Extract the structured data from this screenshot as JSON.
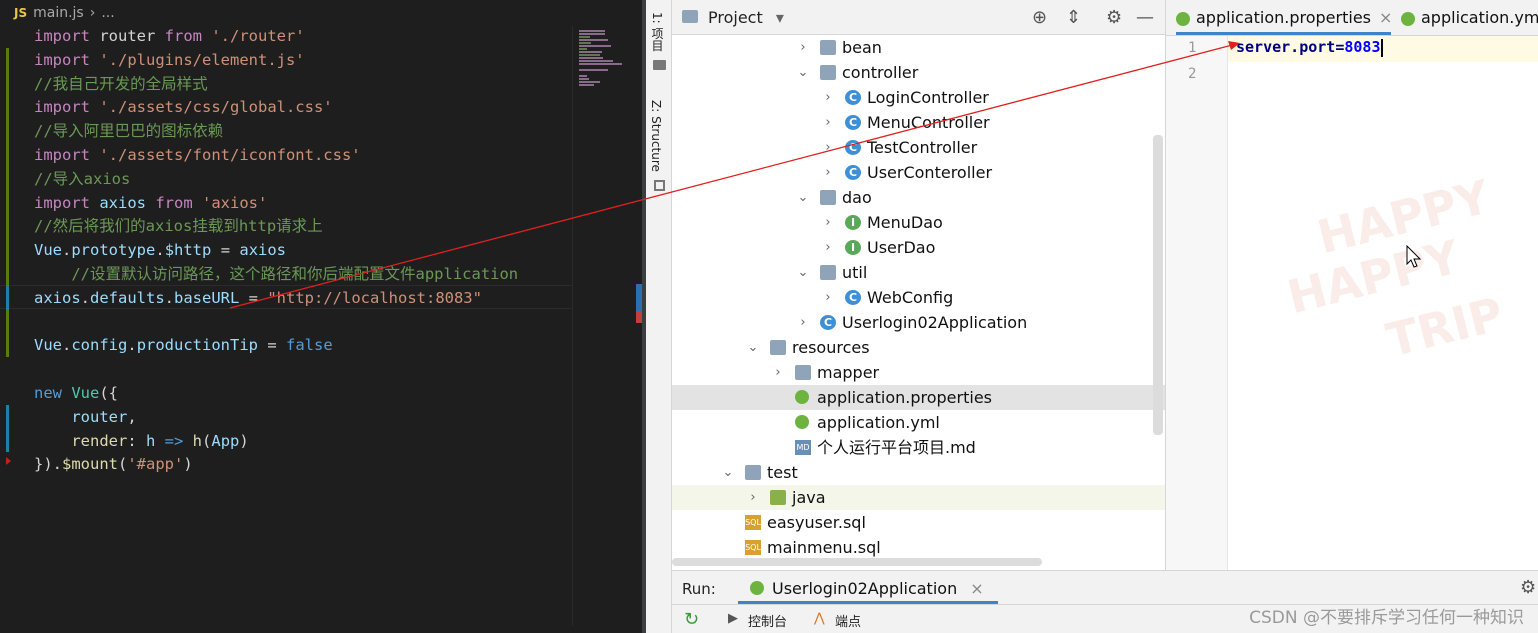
{
  "vscode": {
    "breadcrumb": {
      "badge": "JS",
      "file": "main.js",
      "sep": "›",
      "rest": "..."
    },
    "lines": [
      [
        {
          "c": "kw",
          "t": "import"
        },
        {
          "c": "op",
          "t": " router "
        },
        {
          "c": "kw",
          "t": "from"
        },
        {
          "c": "op",
          "t": " "
        },
        {
          "c": "str",
          "t": "'./router'"
        }
      ],
      [
        {
          "c": "kw",
          "t": "import"
        },
        {
          "c": "op",
          "t": " "
        },
        {
          "c": "str",
          "t": "'./plugins/element.js'"
        }
      ],
      [
        {
          "c": "cmt",
          "t": "//我自己开发的全局样式"
        }
      ],
      [
        {
          "c": "kw",
          "t": "import"
        },
        {
          "c": "op",
          "t": " "
        },
        {
          "c": "str",
          "t": "'./assets/css/global.css'"
        }
      ],
      [
        {
          "c": "cmt",
          "t": "//导入阿里巴巴的图标依赖"
        }
      ],
      [
        {
          "c": "kw",
          "t": "import"
        },
        {
          "c": "op",
          "t": " "
        },
        {
          "c": "str",
          "t": "'./assets/font/iconfont.css'"
        }
      ],
      [
        {
          "c": "cmt",
          "t": "//导入axios"
        }
      ],
      [
        {
          "c": "kw",
          "t": "import"
        },
        {
          "c": "id",
          "t": " axios "
        },
        {
          "c": "kw",
          "t": "from"
        },
        {
          "c": "op",
          "t": " "
        },
        {
          "c": "str",
          "t": "'axios'"
        }
      ],
      [
        {
          "c": "cmt",
          "t": "//然后将我们的axios挂载到http请求上"
        }
      ],
      [
        {
          "c": "id",
          "t": "Vue"
        },
        {
          "c": "op",
          "t": "."
        },
        {
          "c": "id",
          "t": "prototype"
        },
        {
          "c": "op",
          "t": "."
        },
        {
          "c": "id",
          "t": "$http"
        },
        {
          "c": "op",
          "t": " = "
        },
        {
          "c": "id",
          "t": "axios"
        }
      ],
      [
        {
          "c": "op",
          "t": "    "
        },
        {
          "c": "cmt",
          "t": "//设置默认访问路径，这个路径和你后端配置文件application"
        }
      ],
      [
        {
          "c": "id",
          "t": "axios"
        },
        {
          "c": "op",
          "t": "."
        },
        {
          "c": "id",
          "t": "defaults"
        },
        {
          "c": "op",
          "t": "."
        },
        {
          "c": "id",
          "t": "baseURL"
        },
        {
          "c": "op",
          "t": " = "
        },
        {
          "c": "str",
          "t": "\"http://localhost:8083\""
        }
      ],
      [],
      [
        {
          "c": "id",
          "t": "Vue"
        },
        {
          "c": "op",
          "t": "."
        },
        {
          "c": "id",
          "t": "config"
        },
        {
          "c": "op",
          "t": "."
        },
        {
          "c": "id",
          "t": "productionTip"
        },
        {
          "c": "op",
          "t": " = "
        },
        {
          "c": "kw2",
          "t": "false"
        }
      ],
      [],
      [
        {
          "c": "kw2",
          "t": "new"
        },
        {
          "c": "op",
          "t": " "
        },
        {
          "c": "cls",
          "t": "Vue"
        },
        {
          "c": "op",
          "t": "({"
        }
      ],
      [
        {
          "c": "op",
          "t": "    "
        },
        {
          "c": "id",
          "t": "router"
        },
        {
          "c": "op",
          "t": ","
        }
      ],
      [
        {
          "c": "op",
          "t": "    "
        },
        {
          "c": "fn",
          "t": "render"
        },
        {
          "c": "op",
          "t": ": "
        },
        {
          "c": "id",
          "t": "h"
        },
        {
          "c": "kw2",
          "t": " => "
        },
        {
          "c": "fn",
          "t": "h"
        },
        {
          "c": "op",
          "t": "("
        },
        {
          "c": "id",
          "t": "App"
        },
        {
          "c": "op",
          "t": ")"
        }
      ],
      [
        {
          "c": "op",
          "t": "})."
        },
        {
          "c": "fn",
          "t": "$mount"
        },
        {
          "c": "op",
          "t": "("
        },
        {
          "c": "str",
          "t": "'#app'"
        },
        {
          "c": "op",
          "t": ")"
        }
      ]
    ]
  },
  "idea": {
    "side_tabs": {
      "project": "1: 项目",
      "structure": "Z: Structure"
    },
    "project_panel": {
      "title": "Project",
      "dropdown_glyph": "▾",
      "icons": {
        "locate": "⊕",
        "collapse": "⇕",
        "settings": "⚙",
        "hide": "—"
      }
    },
    "tree": [
      {
        "label": "bean",
        "depth": 3,
        "arrow": "›",
        "icon": "folder"
      },
      {
        "label": "controller",
        "depth": 3,
        "arrow": "⌄",
        "icon": "folder"
      },
      {
        "label": "LoginController",
        "depth": 4,
        "arrow": "›",
        "icon": "class-c"
      },
      {
        "label": "MenuController",
        "depth": 4,
        "arrow": "›",
        "icon": "class-c"
      },
      {
        "label": "TestController",
        "depth": 4,
        "arrow": "›",
        "icon": "class-c"
      },
      {
        "label": "UserConteroller",
        "depth": 4,
        "arrow": "›",
        "icon": "class-c"
      },
      {
        "label": "dao",
        "depth": 3,
        "arrow": "⌄",
        "icon": "folder"
      },
      {
        "label": "MenuDao",
        "depth": 4,
        "arrow": "›",
        "icon": "class-i"
      },
      {
        "label": "UserDao",
        "depth": 4,
        "arrow": "›",
        "icon": "class-i"
      },
      {
        "label": "util",
        "depth": 3,
        "arrow": "⌄",
        "icon": "folder"
      },
      {
        "label": "WebConfig",
        "depth": 4,
        "arrow": "›",
        "icon": "class-c"
      },
      {
        "label": "Userlogin02Application",
        "depth": 3,
        "arrow": "›",
        "icon": "spring-c"
      },
      {
        "label": "resources",
        "depth": 1,
        "arrow": "⌄",
        "icon": "folder"
      },
      {
        "label": "mapper",
        "depth": 2,
        "arrow": "›",
        "icon": "folder"
      },
      {
        "label": "application.properties",
        "depth": 2,
        "arrow": "",
        "icon": "spring",
        "selected": true
      },
      {
        "label": "application.yml",
        "depth": 2,
        "arrow": "",
        "icon": "spring"
      },
      {
        "label": "个人运行平台项目.md",
        "depth": 2,
        "arrow": "",
        "icon": "md"
      },
      {
        "label": "test",
        "depth": 0,
        "arrow": "⌄",
        "icon": "folder"
      },
      {
        "label": "java",
        "depth": 1,
        "arrow": "›",
        "icon": "folder-green",
        "test": true
      },
      {
        "label": "easyuser.sql",
        "depth": 0,
        "arrow": "",
        "icon": "sql"
      },
      {
        "label": "mainmenu.sql",
        "depth": 0,
        "arrow": "",
        "icon": "sql"
      }
    ],
    "icon_text": {
      "c": "C",
      "i": "I",
      "md": "MD",
      "sql": "SQL"
    },
    "editor": {
      "tabs": [
        {
          "label": "application.properties",
          "close": "×",
          "active": true
        },
        {
          "label": "application.yml",
          "close": "",
          "active": false
        }
      ],
      "line_numbers": [
        "1",
        "2"
      ],
      "code": {
        "key": "server.port=",
        "value": "8083"
      },
      "watermark": [
        "HAPPY",
        "HAPPY",
        "TRIP"
      ]
    },
    "run_bar": {
      "label": "Run:",
      "tab": "Userlogin02Application",
      "tab_close": "×",
      "console": "控制台",
      "endpoints": "端点",
      "rerun_icon": "↻",
      "console_icon": "▶",
      "settings_icon": "⚙"
    }
  },
  "watermark_text": "CSDN @不要排斥学习任何一种知识",
  "colors": {
    "annotation_line": "#e02020",
    "vscode_bg": "#1e1e1e",
    "accent": "#4083c9"
  }
}
